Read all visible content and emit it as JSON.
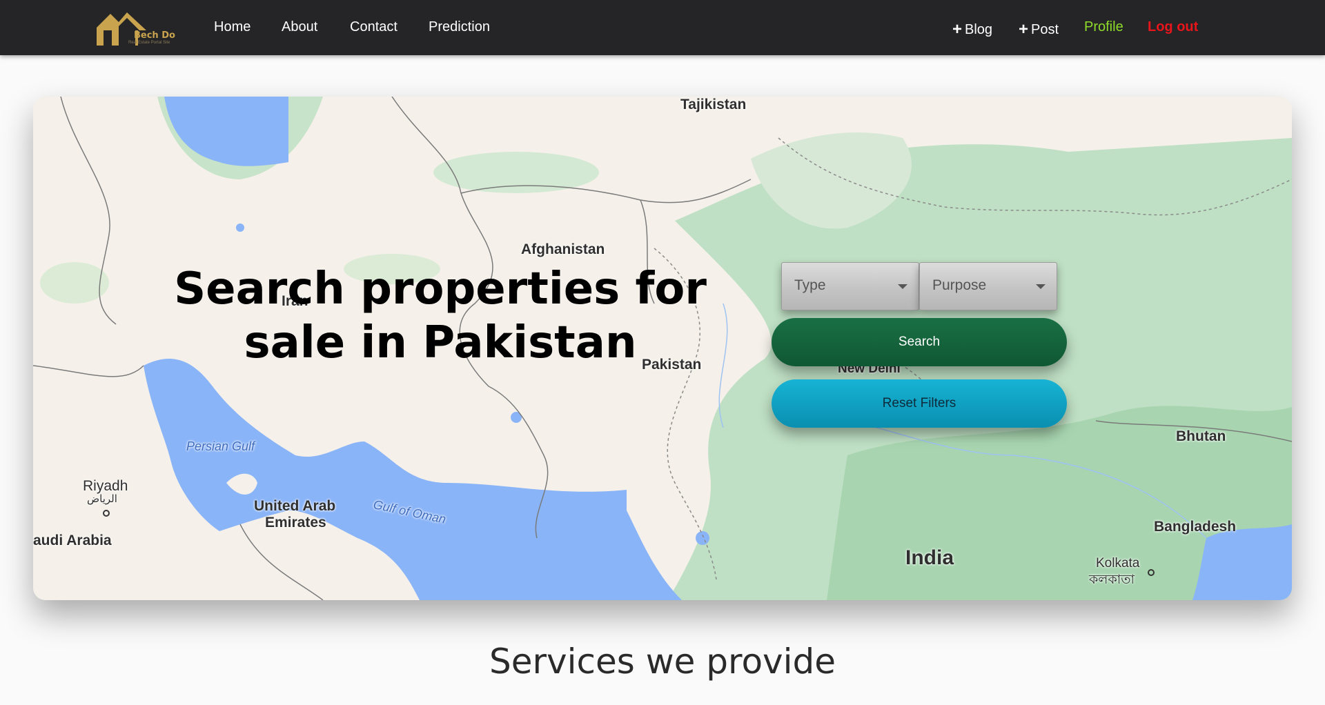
{
  "brand": {
    "name": "Bech Do",
    "tagline": "Real Estate Portal Site",
    "colors": {
      "gold": "#c9a34e",
      "nav_bg": "#252527"
    }
  },
  "nav": {
    "left": [
      "Home",
      "About",
      "Contact",
      "Prediction"
    ],
    "blog": "Blog",
    "post": "Post",
    "profile": "Profile",
    "logout": "Log out"
  },
  "hero": {
    "headline_line1": "Search properties for",
    "headline_line2": "sale in Pakistan",
    "type_placeholder": "Type",
    "purpose_placeholder": "Purpose",
    "search_label": "Search",
    "reset_label": "Reset Filters"
  },
  "map_labels": {
    "tajikistan": "Tajikistan",
    "afghanistan": "Afghanistan",
    "iran": "Iran",
    "pakistan": "Pakistan",
    "new_delhi": "New Delhi",
    "bhutan": "Bhutan",
    "persian_gulf": "Persian Gulf",
    "riyadh": "Riyadh",
    "riyadh_ar": "الرياض",
    "uae_line1": "United Arab",
    "uae_line2": "Emirates",
    "gulf_of_oman": "Gulf of Oman",
    "saudi": "Saudi Arabia",
    "india": "India",
    "bangladesh": "Bangladesh",
    "kolkata": "Kolkata",
    "kolkata_bn": "কলকাতা"
  },
  "services_title": "Services we provide",
  "icons": {
    "logo": "house-roof-logo-icon",
    "plus": "plus-icon",
    "caret": "caret-down-icon"
  }
}
